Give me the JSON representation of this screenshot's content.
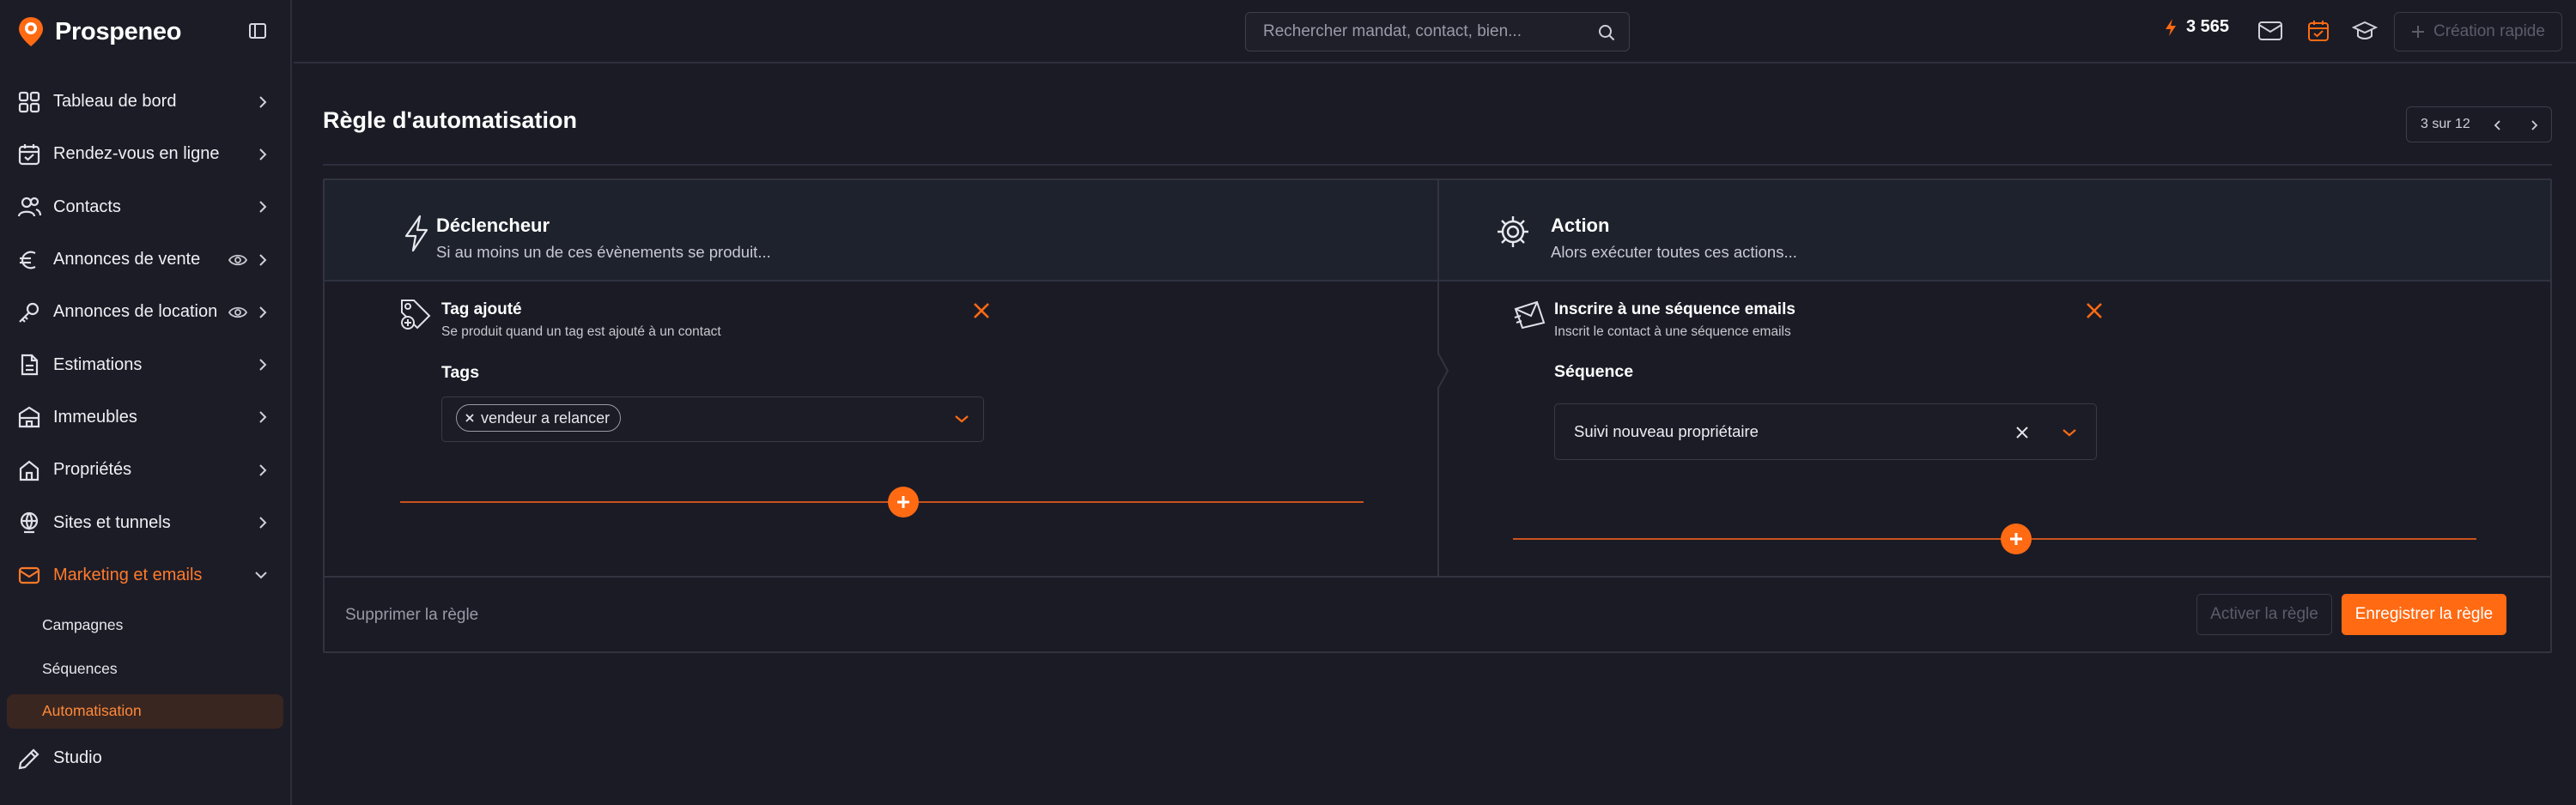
{
  "app": {
    "name": "Prospeneo"
  },
  "sidebar": {
    "items": [
      {
        "label": "Tableau de bord",
        "icon": "grid-icon"
      },
      {
        "label": "Rendez-vous en ligne",
        "icon": "calendar-check-icon"
      },
      {
        "label": "Contacts",
        "icon": "users-icon"
      },
      {
        "label": "Annonces de vente",
        "icon": "euro-icon",
        "eye": true
      },
      {
        "label": "Annonces de location",
        "icon": "key-icon",
        "eye": true
      },
      {
        "label": "Estimations",
        "icon": "document-icon"
      },
      {
        "label": "Immeubles",
        "icon": "building-icon"
      },
      {
        "label": "Propriétés",
        "icon": "home-icon"
      },
      {
        "label": "Sites et tunnels",
        "icon": "globe-icon"
      },
      {
        "label": "Marketing et emails",
        "icon": "mail-icon",
        "active": true,
        "expanded": true
      }
    ],
    "subitems": [
      {
        "label": "Campagnes"
      },
      {
        "label": "Séquences"
      },
      {
        "label": "Automatisation",
        "active": true
      }
    ],
    "studio": {
      "label": "Studio",
      "icon": "pen-icon"
    }
  },
  "topbar": {
    "search_placeholder": "Rechercher mandat, contact, bien...",
    "credits": "3 565",
    "quick_create": "Création rapide"
  },
  "page": {
    "title": "Règle d'automatisation",
    "pager": "3 sur 12"
  },
  "trigger": {
    "title": "Déclencheur",
    "subtitle": "Si au moins un de ces évènements se produit...",
    "card_title": "Tag ajouté",
    "card_sub": "Se produit quand un tag est ajouté à un contact",
    "field_label": "Tags",
    "chip": "vendeur a relancer"
  },
  "action": {
    "title": "Action",
    "subtitle": "Alors exécuter toutes ces actions...",
    "card_title": "Inscrire à une séquence emails",
    "card_sub": "Inscrit le contact à une séquence emails",
    "field_label": "Séquence",
    "value": "Suivi nouveau propriétaire"
  },
  "footer": {
    "delete": "Supprimer la règle",
    "activate": "Activer la règle",
    "save": "Enregistrer la règle"
  },
  "colors": {
    "accent": "#ff6a13",
    "bg": "#1b1b26",
    "header_bg": "#1d222c"
  }
}
